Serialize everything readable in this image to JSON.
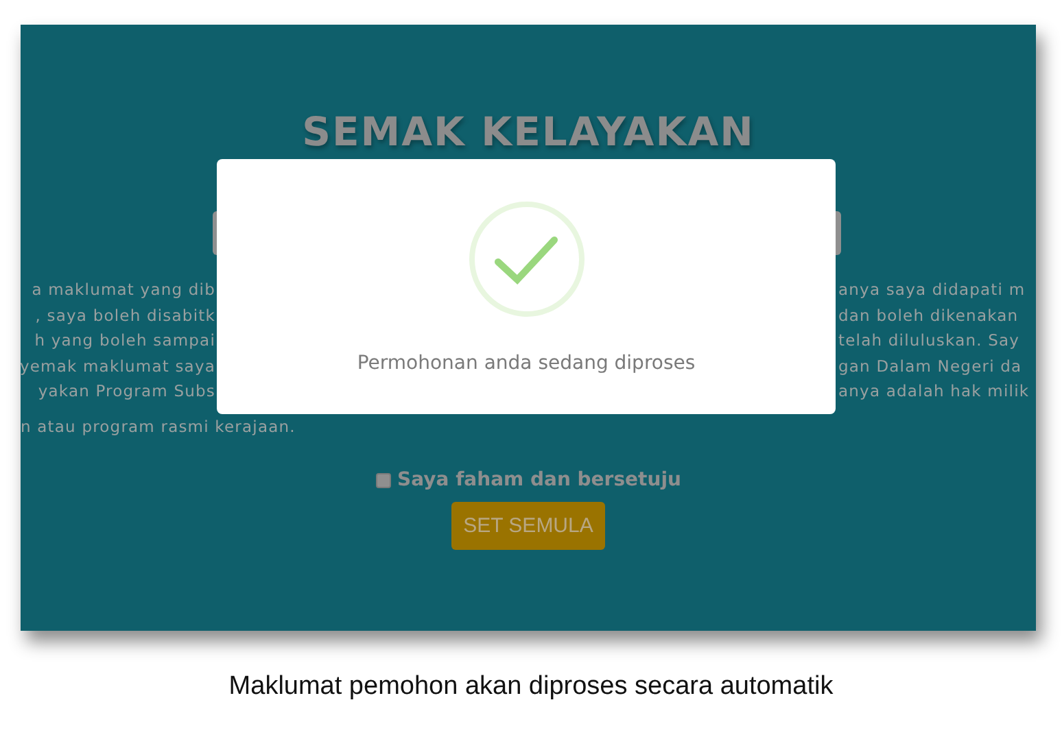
{
  "screen": {
    "title": "SEMAK KELAYAKAN",
    "paragraph_lines": [
      {
        "left": "a maklumat yang dib",
        "right": "anya saya didapati m"
      },
      {
        "left": ", saya boleh disabitk",
        "right": "dan boleh dikenakan"
      },
      {
        "left": "h yang boleh sampai",
        "right": "telah diluluskan. Say"
      },
      {
        "left": "yemak maklumat saya",
        "right": "gan Dalam Negeri da"
      },
      {
        "left": "yakan Program Subs",
        "right": "anya adalah hak milik"
      },
      {
        "left": "n atau program rasmi kerajaan."
      }
    ],
    "agreement": {
      "label": "Saya faham dan bersetuju",
      "checked": false
    },
    "reset_button": "SET SEMULA"
  },
  "dialog": {
    "message": "Permohonan anda sedang diproses"
  },
  "caption": "Maklumat pemohon akan diproses secara automatik"
}
